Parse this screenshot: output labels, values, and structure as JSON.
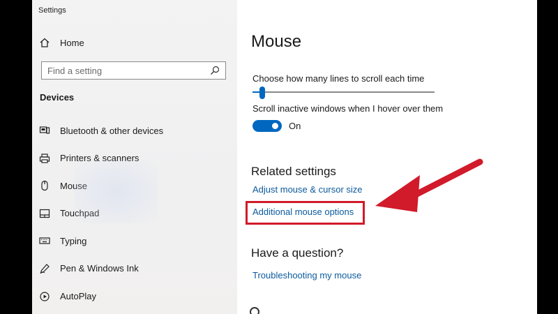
{
  "window": {
    "title": "Settings"
  },
  "sidebar": {
    "home_label": "Home",
    "search_placeholder": "Find a setting",
    "section_heading": "Devices",
    "items": [
      {
        "label": "Bluetooth & other devices",
        "icon": "bluetooth-devices-icon"
      },
      {
        "label": "Printers & scanners",
        "icon": "printer-icon"
      },
      {
        "label": "Mouse",
        "icon": "mouse-icon"
      },
      {
        "label": "Touchpad",
        "icon": "touchpad-icon"
      },
      {
        "label": "Typing",
        "icon": "keyboard-icon"
      },
      {
        "label": "Pen & Windows Ink",
        "icon": "pen-icon"
      },
      {
        "label": "AutoPlay",
        "icon": "autoplay-icon"
      }
    ]
  },
  "main": {
    "title": "Mouse",
    "scroll_lines_label": "Choose how many lines to scroll each time",
    "scroll_lines_value": 0.04,
    "inactive_scroll_label": "Scroll inactive windows when I hover over them",
    "inactive_scroll_state": "On",
    "related_heading": "Related settings",
    "links": {
      "adjust_cursor": "Adjust mouse & cursor size",
      "additional_options": "Additional mouse options"
    },
    "question_heading": "Have a question?",
    "troubleshoot_link": "Troubleshooting my mouse"
  },
  "colors": {
    "accent": "#0067c0",
    "link": "#0a5a9c",
    "annotation": "#d11a2a"
  }
}
